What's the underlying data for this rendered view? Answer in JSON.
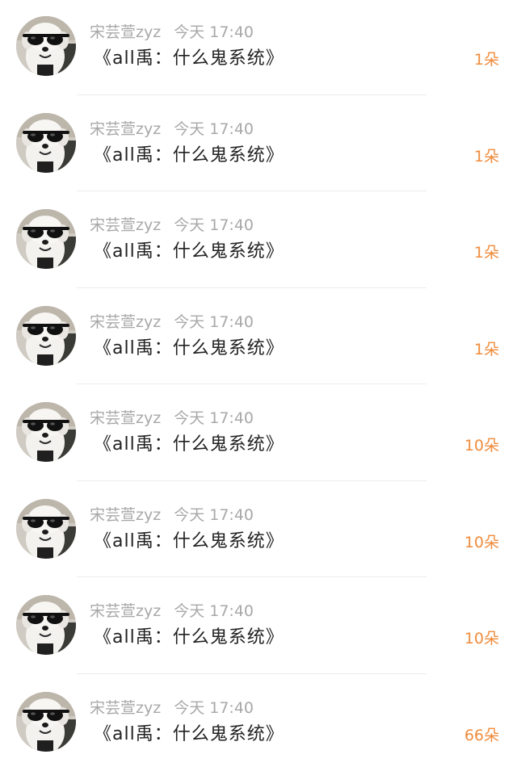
{
  "colors": {
    "meta": "#a8a8a8",
    "title": "#222222",
    "count": "#f08c3c",
    "divider": "#ececec"
  },
  "items": [
    {
      "user": "宋芸萱zyz",
      "time": "今天 17:40",
      "title": "《all禹：什么鬼系统》",
      "count": "1朵",
      "avatar_icon": "dog-with-sunglasses-avatar"
    },
    {
      "user": "宋芸萱zyz",
      "time": "今天 17:40",
      "title": "《all禹：什么鬼系统》",
      "count": "1朵",
      "avatar_icon": "dog-with-sunglasses-avatar"
    },
    {
      "user": "宋芸萱zyz",
      "time": "今天 17:40",
      "title": "《all禹：什么鬼系统》",
      "count": "1朵",
      "avatar_icon": "dog-with-sunglasses-avatar"
    },
    {
      "user": "宋芸萱zyz",
      "time": "今天 17:40",
      "title": "《all禹：什么鬼系统》",
      "count": "1朵",
      "avatar_icon": "dog-with-sunglasses-avatar"
    },
    {
      "user": "宋芸萱zyz",
      "time": "今天 17:40",
      "title": "《all禹：什么鬼系统》",
      "count": "10朵",
      "avatar_icon": "dog-with-sunglasses-avatar"
    },
    {
      "user": "宋芸萱zyz",
      "time": "今天 17:40",
      "title": "《all禹：什么鬼系统》",
      "count": "10朵",
      "avatar_icon": "dog-with-sunglasses-avatar"
    },
    {
      "user": "宋芸萱zyz",
      "time": "今天 17:40",
      "title": "《all禹：什么鬼系统》",
      "count": "10朵",
      "avatar_icon": "dog-with-sunglasses-avatar"
    },
    {
      "user": "宋芸萱zyz",
      "time": "今天 17:40",
      "title": "《all禹：什么鬼系统》",
      "count": "66朵",
      "avatar_icon": "dog-with-sunglasses-avatar"
    }
  ]
}
